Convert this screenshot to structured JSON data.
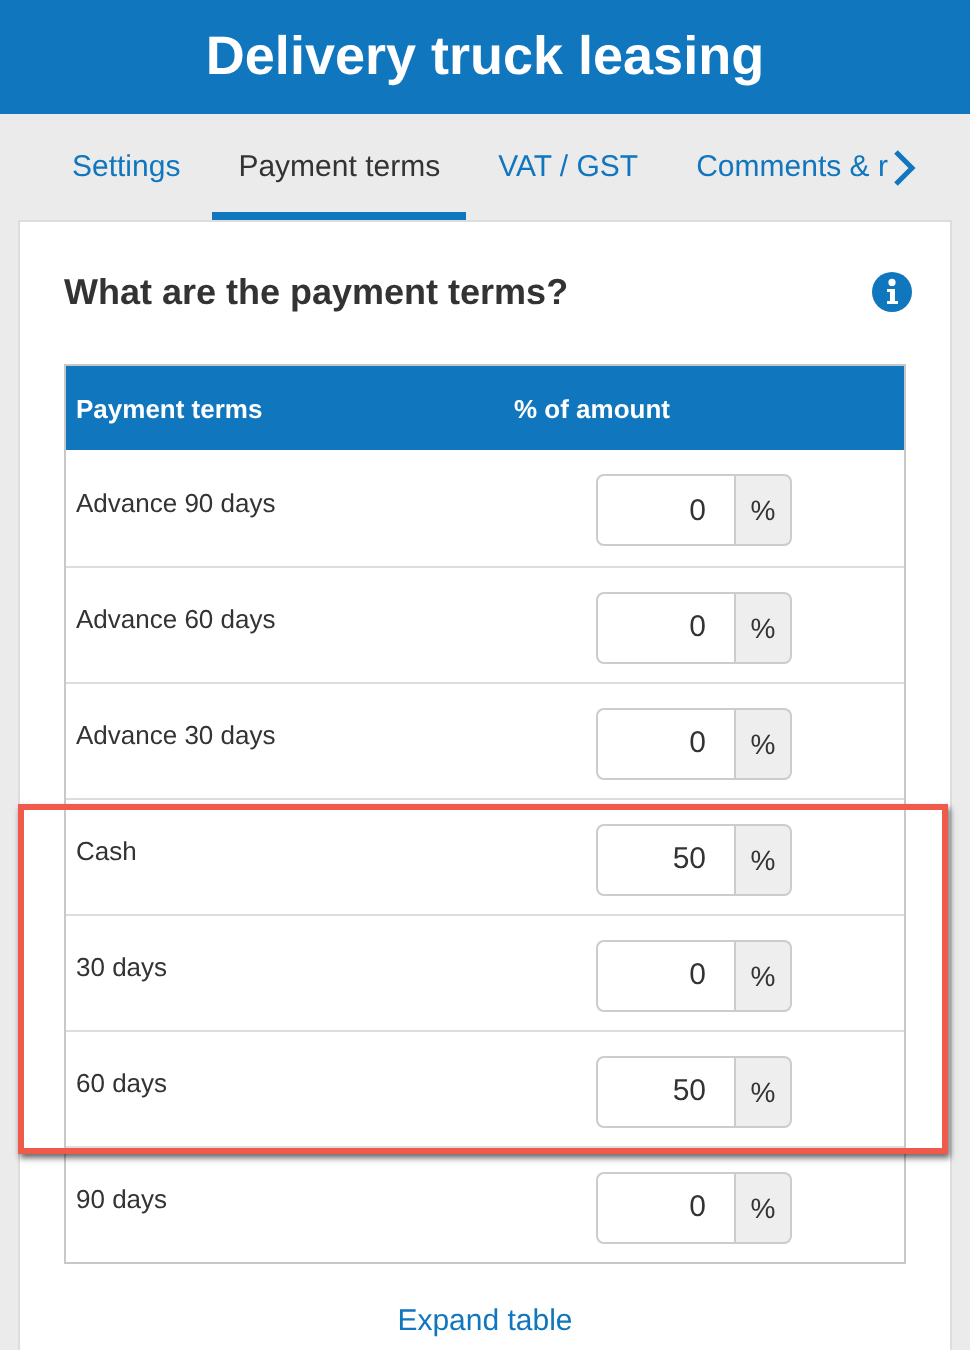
{
  "header": {
    "title": "Delivery truck leasing"
  },
  "tabs": [
    {
      "label": "Settings",
      "selected": false
    },
    {
      "label": "Payment terms",
      "selected": true
    },
    {
      "label": "VAT / GST",
      "selected": false
    },
    {
      "label": "Comments & r",
      "selected": false
    }
  ],
  "card": {
    "title": "What are the payment terms?",
    "table": {
      "columns": [
        "Payment terms",
        "% of amount"
      ],
      "rows": [
        {
          "term": "Advance 90 days",
          "value": "0",
          "unit": "%",
          "highlighted": false
        },
        {
          "term": "Advance 60 days",
          "value": "0",
          "unit": "%",
          "highlighted": false
        },
        {
          "term": "Advance 30 days",
          "value": "0",
          "unit": "%",
          "highlighted": false
        },
        {
          "term": "Cash",
          "value": "50",
          "unit": "%",
          "highlighted": true
        },
        {
          "term": "30 days",
          "value": "0",
          "unit": "%",
          "highlighted": true
        },
        {
          "term": "60 days",
          "value": "50",
          "unit": "%",
          "highlighted": true
        },
        {
          "term": "90 days",
          "value": "0",
          "unit": "%",
          "highlighted": false
        }
      ]
    },
    "expand_link": "Expand table"
  }
}
